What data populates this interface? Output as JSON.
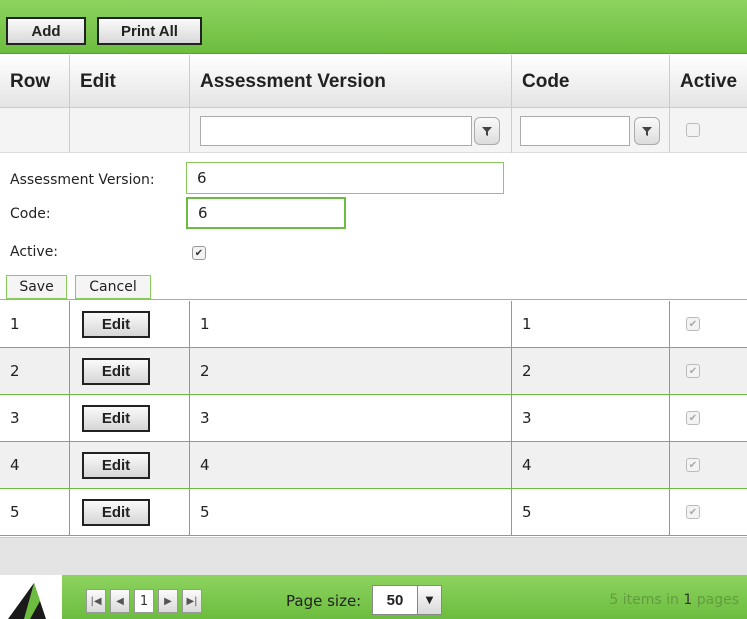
{
  "toolbar": {
    "add_label": "Add",
    "print_all_label": "Print All"
  },
  "columns": {
    "row": "Row",
    "edit": "Edit",
    "version": "Assessment Version",
    "code": "Code",
    "active": "Active"
  },
  "edit_form": {
    "version_label": "Assessment Version:",
    "version_value": "6",
    "code_label": "Code:",
    "code_value": "6",
    "active_label": "Active:",
    "active_checked": true,
    "save_label": "Save",
    "cancel_label": "Cancel"
  },
  "rows": [
    {
      "row": "1",
      "edit": "Edit",
      "version": "1",
      "code": "1",
      "active": true
    },
    {
      "row": "2",
      "edit": "Edit",
      "version": "2",
      "code": "2",
      "active": true
    },
    {
      "row": "3",
      "edit": "Edit",
      "version": "3",
      "code": "3",
      "active": true
    },
    {
      "row": "4",
      "edit": "Edit",
      "version": "4",
      "code": "4",
      "active": true
    },
    {
      "row": "5",
      "edit": "Edit",
      "version": "5",
      "code": "5",
      "active": true
    }
  ],
  "pager": {
    "current_page": "1",
    "page_size_label": "Page size:",
    "page_size_value": "50",
    "summary_count": "5 items in",
    "summary_pages": "1",
    "summary_suffix": "pages"
  },
  "colors": {
    "accent_green": "#6cbd3f",
    "border_green": "#8aca5c"
  }
}
